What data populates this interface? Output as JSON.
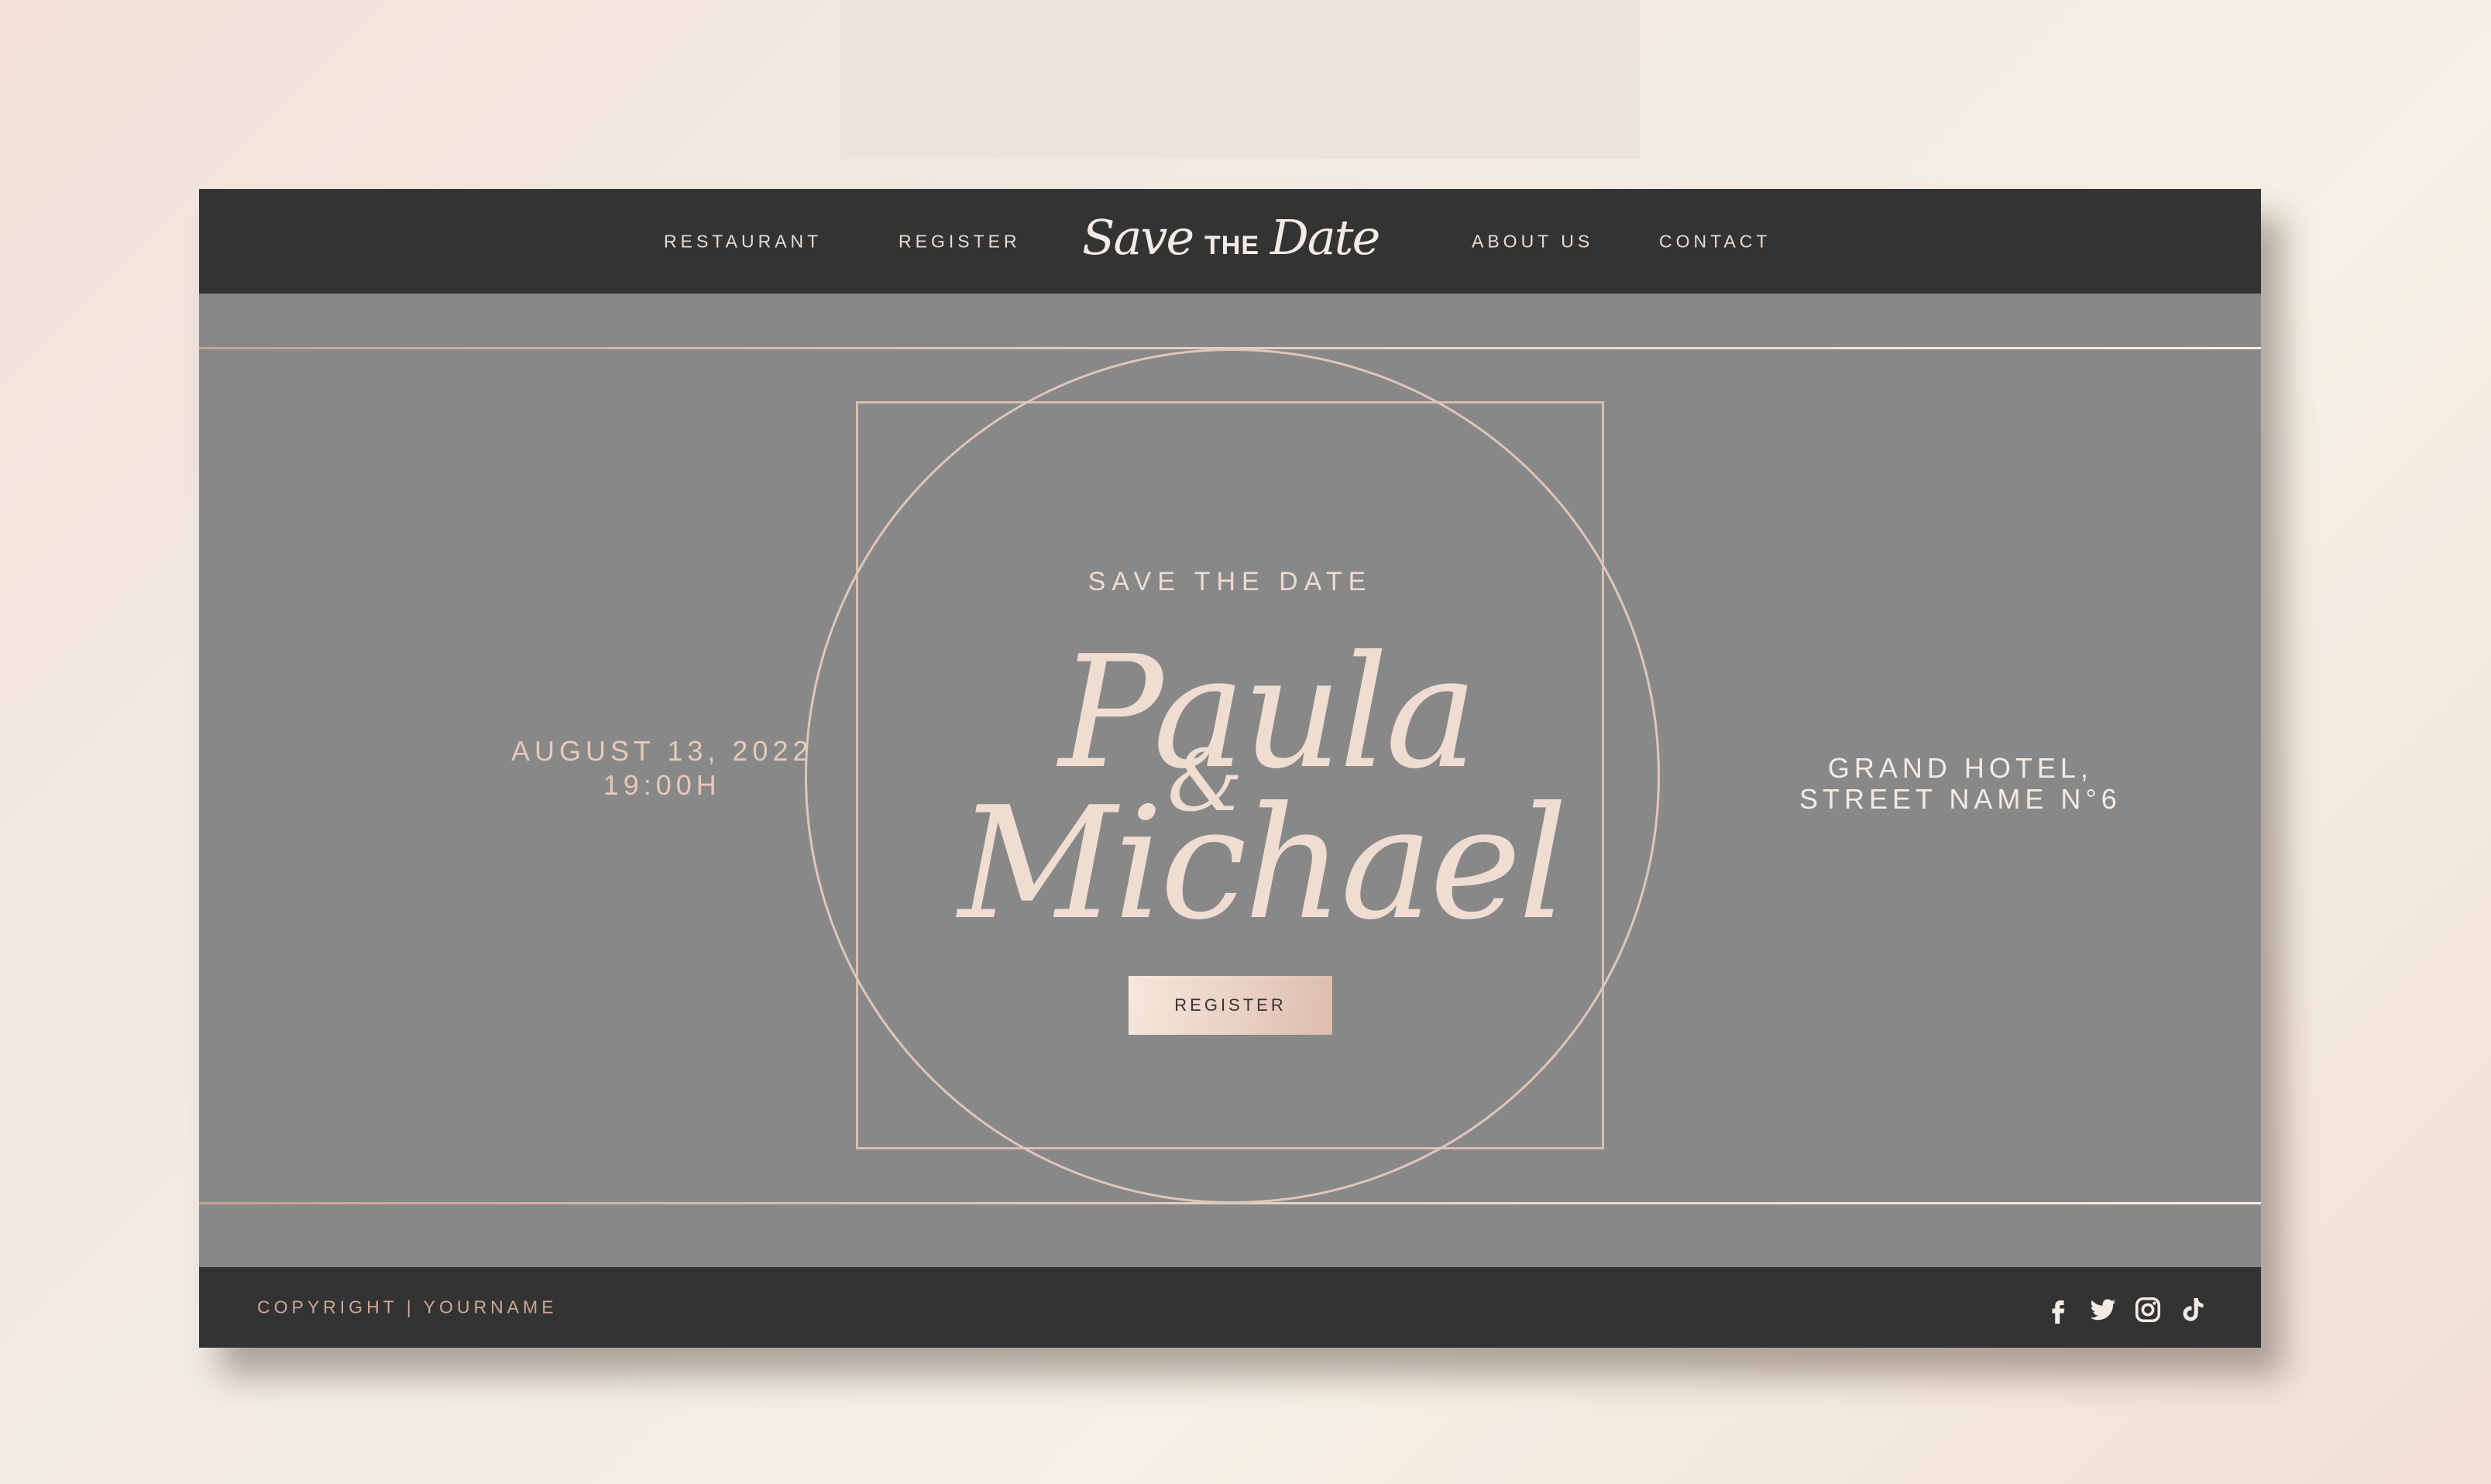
{
  "nav": {
    "items": [
      "RESTAURANT",
      "REGISTER",
      "ABOUT US",
      "CONTACT"
    ]
  },
  "logo": {
    "part1": "Save",
    "part2": "THE",
    "part3": "Date"
  },
  "hero": {
    "kicker": "SAVE THE DATE",
    "name1": "Paula",
    "ampersand": "&",
    "name2": "Michael",
    "button_label": "REGISTER",
    "date_line1": "AUGUST 13, 2022",
    "date_line2": "19:00H",
    "venue_line1": "GRAND HOTEL,",
    "venue_line2": "STREET NAME N°6"
  },
  "footer": {
    "copyright": "COPYRIGHT | YOURNAME",
    "socials": [
      "facebook-icon",
      "twitter-icon",
      "instagram-icon",
      "tiktok-icon"
    ]
  },
  "colors": {
    "bar": "#333333",
    "hero_bg": "#888888",
    "rose_gold": "#dcbcb0",
    "text_light": "#f0ddd2"
  }
}
